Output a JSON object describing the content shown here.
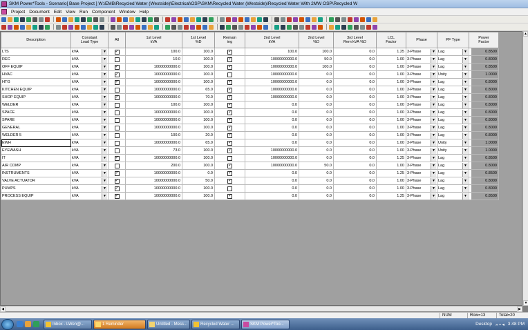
{
  "window": {
    "title": "SKM Power*Tools - Scenario[ Base Project ] W:\\EMB\\Recycled Water (Westside)\\Electrical\\OSP\\SKM\\Recycled Water (Westside)\\Recycled Water With 2MW OSP\\Recycled W"
  },
  "menu": [
    "Project",
    "Document",
    "Edit",
    "View",
    "Run",
    "Component",
    "Window",
    "Help"
  ],
  "columns": [
    "Description",
    "Constant\nLoad Type",
    "All",
    "1st Level\nkVA",
    "1st Level\n%D",
    "Remain\ning",
    "2nd Level\nkVA",
    "2nd Level\n%D",
    "3rd Level\nRem kVA %D",
    "LCL\nFactor",
    "Phase",
    "PF Type",
    "Power\nFactor"
  ],
  "rows": [
    {
      "desc": "LTS",
      "load": "kVA",
      "all": true,
      "l1kva": "100.0",
      "l1pd": "100.0",
      "rem": true,
      "l2kva": "100.0",
      "l2pd": "100.0",
      "l3": "0.0",
      "lcl": "1.25",
      "phase": "3-Phase",
      "pf": "Lag",
      "pfv": "0.8500"
    },
    {
      "desc": "REC",
      "load": "kVA",
      "all": false,
      "l1kva": "10.0",
      "l1pd": "100.0",
      "rem": true,
      "l2kva": "10000000000.0",
      "l2pd": "50.0",
      "l3": "0.0",
      "lcl": "1.00",
      "phase": "3-Phase",
      "pf": "Lag",
      "pfv": "0.8000"
    },
    {
      "desc": "OFF EQUIP",
      "load": "kVA",
      "all": true,
      "l1kva": "10000000000.0",
      "l1pd": "100.0",
      "rem": true,
      "l2kva": "10000000000.0",
      "l2pd": "100.0",
      "l3": "0.0",
      "lcl": "1.00",
      "phase": "3-Phase",
      "pf": "Lag",
      "pfv": "0.8500"
    },
    {
      "desc": "HVAC",
      "load": "kVA",
      "all": true,
      "l1kva": "10000000000.0",
      "l1pd": "100.0",
      "rem": false,
      "l2kva": "10000000000.0",
      "l2pd": "0.0",
      "l3": "0.0",
      "lcl": "1.00",
      "phase": "3-Phase",
      "pf": "Unity",
      "pfv": "1.0000"
    },
    {
      "desc": "HTG",
      "load": "kVA",
      "all": true,
      "l1kva": "10000000000.0",
      "l1pd": "100.0",
      "rem": true,
      "l2kva": "10000000000.0",
      "l2pd": "0.0",
      "l3": "0.0",
      "lcl": "1.00",
      "phase": "3-Phase",
      "pf": "Lag",
      "pfv": "0.8000"
    },
    {
      "desc": "KITCHEN EQUIP",
      "load": "kVA",
      "all": false,
      "l1kva": "10000000000.0",
      "l1pd": "65.0",
      "rem": true,
      "l2kva": "10000000000.0",
      "l2pd": "0.0",
      "l3": "0.0",
      "lcl": "1.00",
      "phase": "3-Phase",
      "pf": "Lag",
      "pfv": "0.8000"
    },
    {
      "desc": "SHOP EQUIP",
      "load": "kVA",
      "all": true,
      "l1kva": "10000000000.0",
      "l1pd": "70.0",
      "rem": true,
      "l2kva": "10000000000.0",
      "l2pd": "0.0",
      "l3": "0.0",
      "lcl": "1.00",
      "phase": "3-Phase",
      "pf": "Lag",
      "pfv": "0.8000"
    },
    {
      "desc": "WELDER",
      "load": "kVA",
      "all": false,
      "l1kva": "100.0",
      "l1pd": "100.0",
      "rem": true,
      "l2kva": "0.0",
      "l2pd": "0.0",
      "l3": "0.0",
      "lcl": "1.00",
      "phase": "3-Phase",
      "pf": "Lag",
      "pfv": "0.8000"
    },
    {
      "desc": "SPACE",
      "load": "kVA",
      "all": false,
      "l1kva": "10000000000.0",
      "l1pd": "100.0",
      "rem": true,
      "l2kva": "0.0",
      "l2pd": "0.0",
      "l3": "0.0",
      "lcl": "1.00",
      "phase": "3-Phase",
      "pf": "Lag",
      "pfv": "0.8000"
    },
    {
      "desc": "SPARE",
      "load": "kVA",
      "all": false,
      "l1kva": "10000000000.0",
      "l1pd": "100.0",
      "rem": true,
      "l2kva": "0.0",
      "l2pd": "0.0",
      "l3": "0.0",
      "lcl": "1.00",
      "phase": "3-Phase",
      "pf": "Lag",
      "pfv": "0.8000"
    },
    {
      "desc": "GENERAL",
      "load": "kVA",
      "all": false,
      "l1kva": "10000000000.0",
      "l1pd": "100.0",
      "rem": true,
      "l2kva": "0.0",
      "l2pd": "0.0",
      "l3": "0.0",
      "lcl": "1.00",
      "phase": "3-Phase",
      "pf": "Lag",
      "pfv": "0.8000"
    },
    {
      "desc": "WELDER 5",
      "load": "kVA",
      "all": false,
      "l1kva": "100.0",
      "l1pd": "20.0",
      "rem": true,
      "l2kva": "0.0",
      "l2pd": "0.0",
      "l3": "0.0",
      "lcl": "1.00",
      "phase": "3-Phase",
      "pf": "Lag",
      "pfv": "0.8000"
    },
    {
      "desc": "EWH",
      "load": "kVA",
      "all": false,
      "l1kva": "10000000000.0",
      "l1pd": "65.0",
      "rem": true,
      "l2kva": "0.0",
      "l2pd": "0.0",
      "l3": "0.0",
      "lcl": "1.00",
      "phase": "3-Phase",
      "pf": "Unity",
      "pfv": "1.0000",
      "selected": true
    },
    {
      "desc": "EYEWASH",
      "load": "kVA",
      "all": false,
      "l1kva": "73.0",
      "l1pd": "100.0",
      "rem": true,
      "l2kva": "10000000000.0",
      "l2pd": "0.0",
      "l3": "0.0",
      "lcl": "1.00",
      "phase": "3-Phase",
      "pf": "Unity",
      "pfv": "1.0000"
    },
    {
      "desc": "IT",
      "load": "kVA",
      "all": true,
      "l1kva": "10000000000.0",
      "l1pd": "100.0",
      "rem": false,
      "l2kva": "10000000000.0",
      "l2pd": "0.0",
      "l3": "0.0",
      "lcl": "1.25",
      "phase": "3-Phase",
      "pf": "Lag",
      "pfv": "0.8500"
    },
    {
      "desc": "AIR COMP",
      "load": "kVA",
      "all": false,
      "l1kva": "200.0",
      "l1pd": "100.0",
      "rem": true,
      "l2kva": "10000000000.0",
      "l2pd": "50.0",
      "l3": "0.0",
      "lcl": "1.00",
      "phase": "3-Phase",
      "pf": "Lag",
      "pfv": "0.8000"
    },
    {
      "desc": "INSTRUMENTS",
      "load": "kVA",
      "all": true,
      "l1kva": "10000000000.0",
      "l1pd": "0.0",
      "rem": true,
      "l2kva": "0.0",
      "l2pd": "0.0",
      "l3": "0.0",
      "lcl": "1.25",
      "phase": "3-Phase",
      "pf": "Lag",
      "pfv": "0.8500"
    },
    {
      "desc": "VALVE ACTUATOR",
      "load": "kVA",
      "all": true,
      "l1kva": "10000000000.0",
      "l1pd": "50.0",
      "rem": true,
      "l2kva": "0.0",
      "l2pd": "0.0",
      "l3": "0.0",
      "lcl": "1.00",
      "phase": "3-Phase",
      "pf": "Lag",
      "pfv": "0.8000"
    },
    {
      "desc": "PUMPS",
      "load": "kVA",
      "all": true,
      "l1kva": "10000000000.0",
      "l1pd": "100.0",
      "rem": false,
      "l2kva": "0.0",
      "l2pd": "0.0",
      "l3": "0.0",
      "lcl": "1.00",
      "phase": "3-Phase",
      "pf": "Lag",
      "pfv": "0.8000"
    },
    {
      "desc": "PROCESS EQUIP",
      "load": "kVA",
      "all": true,
      "l1kva": "10000000000.0",
      "l1pd": "100.0",
      "rem": true,
      "l2kva": "0.0",
      "l2pd": "0.0",
      "l3": "0.0",
      "lcl": "1.25",
      "phase": "3-Phase",
      "pf": "Lag",
      "pfv": "0.8500"
    }
  ],
  "status": {
    "num": "NUM",
    "row": "Row=13",
    "total": "Total=20"
  },
  "taskbar": {
    "items": [
      "Inbox - LWen@...",
      "1 Reminder",
      "Untitled - Mess...",
      "Recycled Water ...",
      "SKM Power*Too..."
    ],
    "desktop": "Desktop",
    "clock": "3:48 PM"
  }
}
